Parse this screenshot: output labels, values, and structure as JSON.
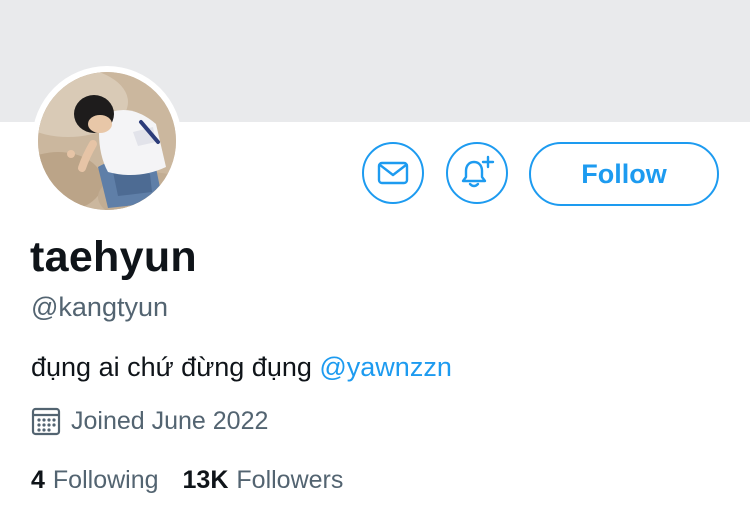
{
  "profile": {
    "display_name": "taehyun",
    "handle": "@kangtyun",
    "bio_text": "đụng ai chứ đừng đụng ",
    "bio_mention": "@yawnzzn",
    "joined": "Joined June 2022"
  },
  "actions": {
    "message_icon": "mail-icon",
    "notify_icon": "bell-plus-icon",
    "follow_label": "Follow"
  },
  "stats": {
    "following_count": "4",
    "following_label": "Following",
    "followers_count": "13K",
    "followers_label": "Followers"
  },
  "colors": {
    "accent": "#1d9bf0",
    "secondary_text": "#536471",
    "primary_text": "#0f1419",
    "banner": "#e9eaec"
  }
}
